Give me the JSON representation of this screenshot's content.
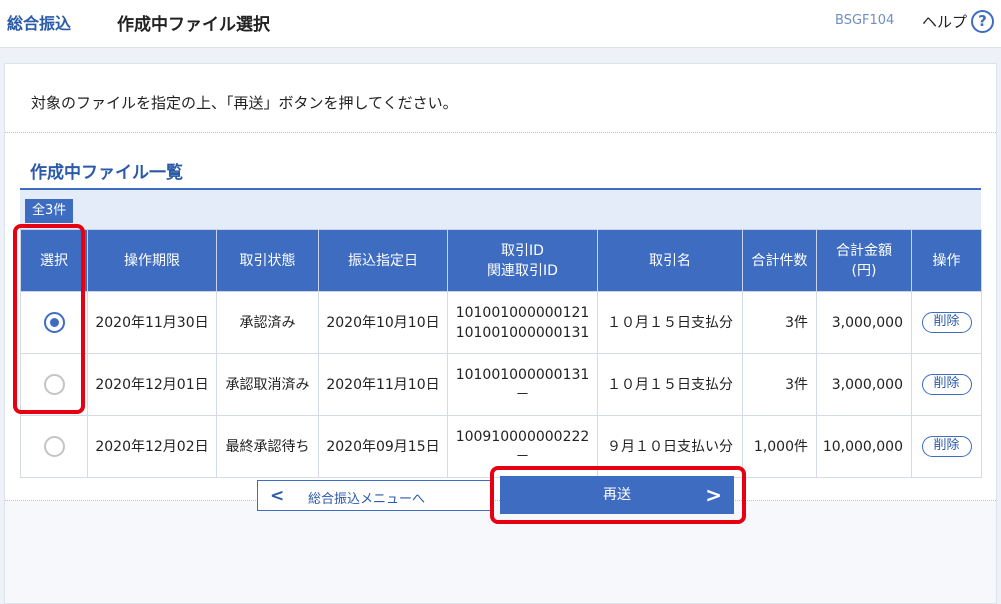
{
  "header": {
    "service_name": "総合振込",
    "page_title": "作成中ファイル選択",
    "screen_id": "BSGF104",
    "help_label": "ヘルプ",
    "help_icon_glyph": "?"
  },
  "instruction": "対象のファイルを指定の上、「再送」ボタンを押してください。",
  "section_title": "作成中ファイル一覧",
  "count_badge": "全3件",
  "table": {
    "headers": [
      "選択",
      "操作期限",
      "取引状態",
      "振込指定日",
      "取引ID",
      "関連取引ID",
      "取引名",
      "合計件数",
      "合計金額",
      "(円)",
      "操作"
    ],
    "rows": [
      {
        "selected": true,
        "deadline": "2020年11月30日",
        "status": "承認済み",
        "transfer_date": "2020年10月10日",
        "trade_id": "101001000000121",
        "related_id": "101001000000131",
        "name": "１０月１５日支払分",
        "count": "3件",
        "amount": "3,000,000",
        "action": "削除"
      },
      {
        "selected": false,
        "deadline": "2020年12月01日",
        "status": "承認取消済み",
        "transfer_date": "2020年11月10日",
        "trade_id": "101001000000131",
        "related_id": "－",
        "name": "１０月１５日支払分",
        "count": "3件",
        "amount": "3,000,000",
        "action": "削除"
      },
      {
        "selected": false,
        "deadline": "2020年12月02日",
        "status": "最終承認待ち",
        "transfer_date": "2020年09月15日",
        "trade_id": "100910000000222",
        "related_id": "－",
        "name": "９月１０日支払い分",
        "count": "1,000件",
        "amount": "10,000,000",
        "action": "削除"
      }
    ]
  },
  "buttons": {
    "back_label": "総合振込メニューへ",
    "back_chevron": "<",
    "resend_label": "再送",
    "resend_chevron": ">"
  },
  "colors": {
    "accent": "#3d6cc0",
    "highlight": "#e60012"
  }
}
